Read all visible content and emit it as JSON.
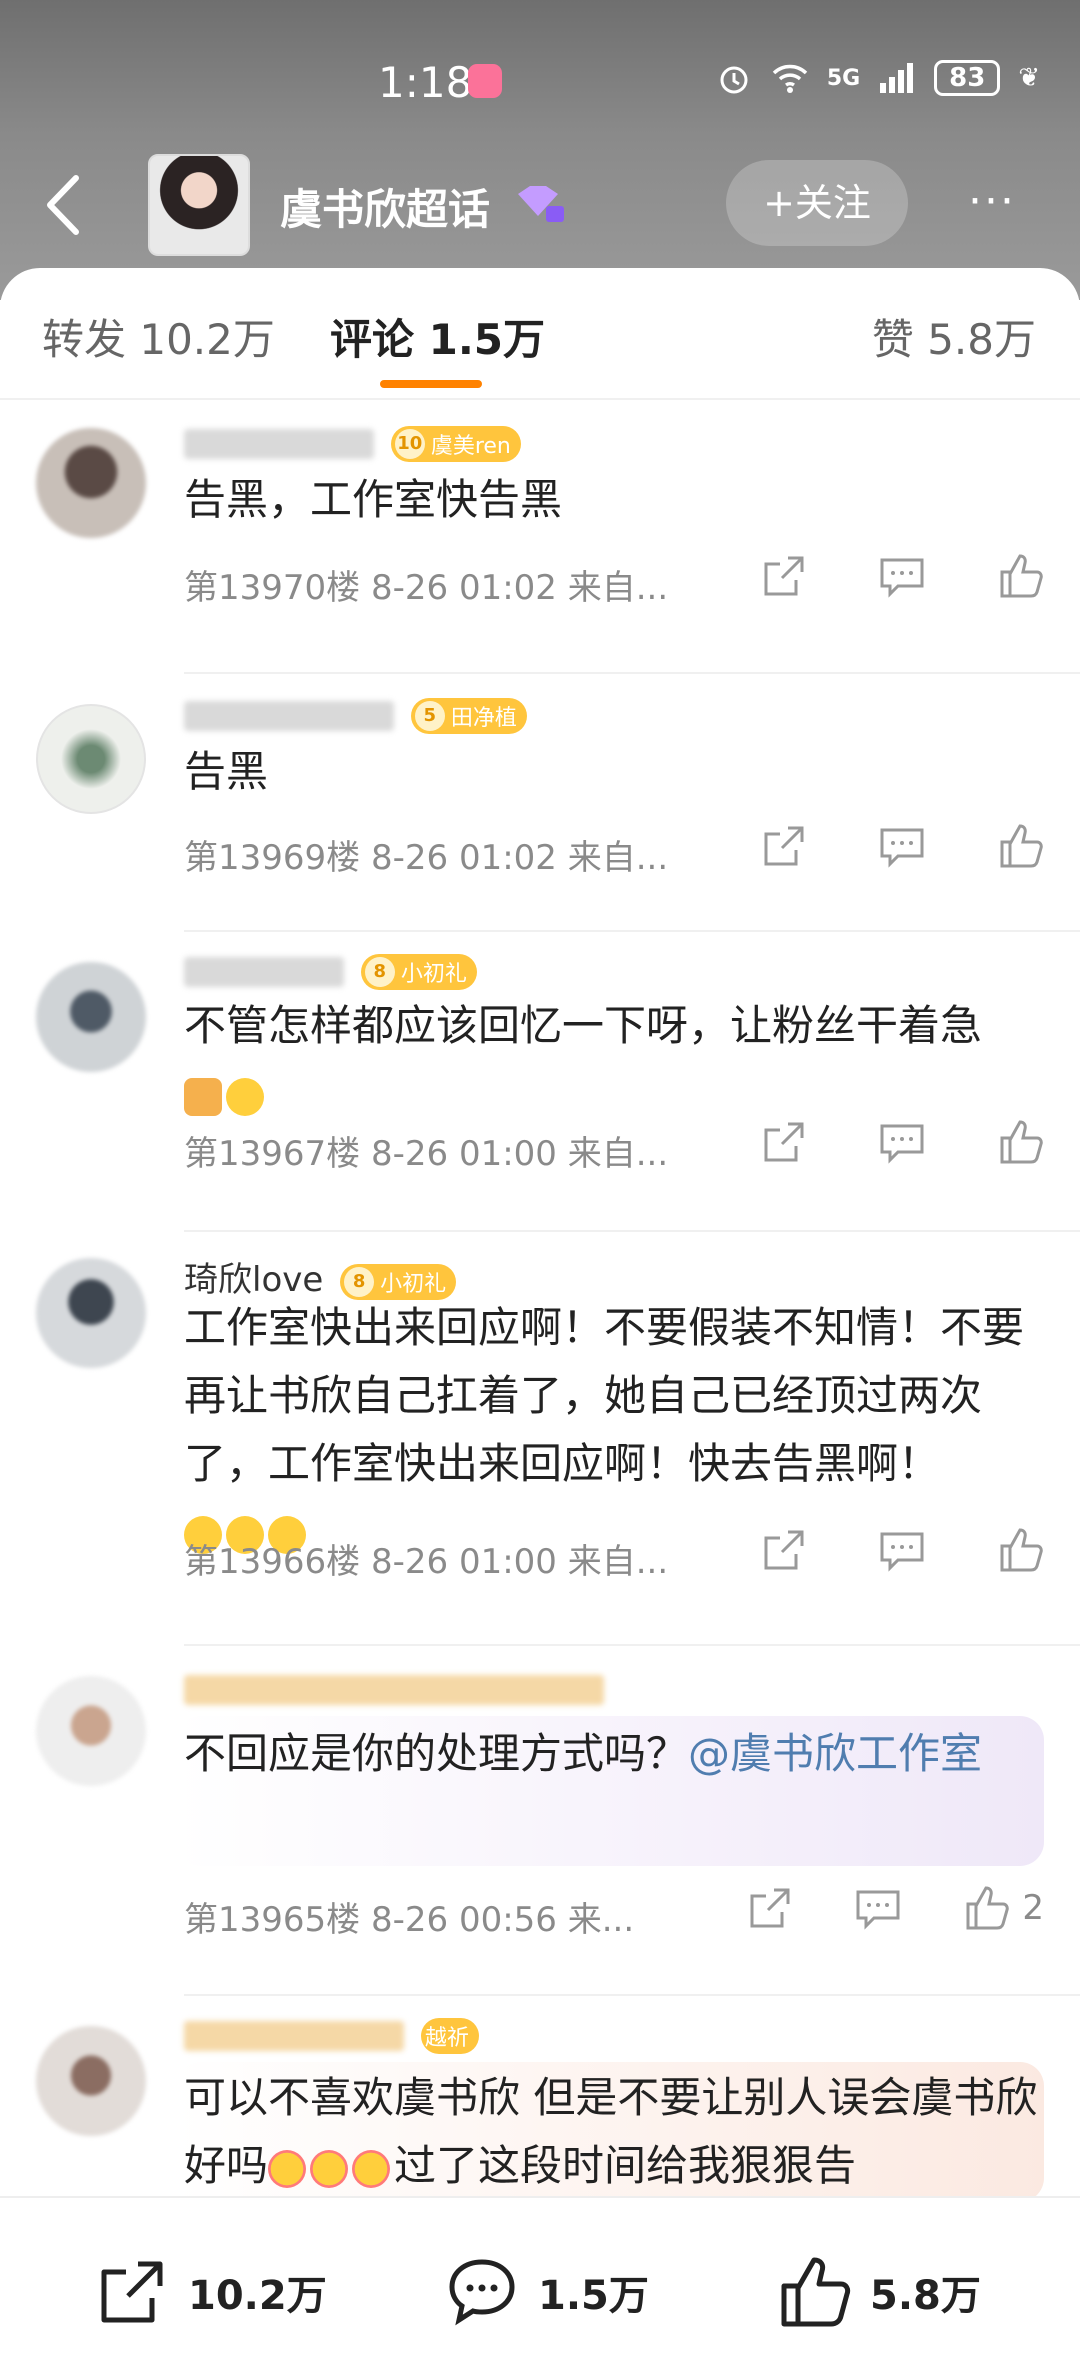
{
  "status_bar": {
    "time": "1:18",
    "network": "5G",
    "battery": "83"
  },
  "header": {
    "title": "虞书欣超话",
    "follow_label": "+关注",
    "more_label": "···"
  },
  "tabs": {
    "repost": "转发 10.2万",
    "comment": "评论 1.5万",
    "like": "赞 5.8万"
  },
  "comments": [
    {
      "name": "",
      "badge_level": "10",
      "badge_text": "虞美ren",
      "text": "告黑，工作室快告黑",
      "meta": "第13970楼  8-26 01:02  来自...",
      "likes": ""
    },
    {
      "name": "",
      "badge_level": "5",
      "badge_text": "田净植",
      "text": "告黑",
      "meta": "第13969楼  8-26 01:02  来自...",
      "likes": ""
    },
    {
      "name": "",
      "badge_level": "8",
      "badge_text": "小初礼",
      "text": "不管怎样都应该回忆一下呀，让粉丝干着急",
      "meta": "第13967楼  8-26 01:00  来自...",
      "likes": ""
    },
    {
      "name": "琦欣love",
      "badge_level": "8",
      "badge_text": "小初礼",
      "text": "工作室快出来回应啊！不要假装不知情！不要再让书欣自己扛着了，她自己已经顶过两次了，工作室快出来回应啊！快去告黑啊！",
      "meta": "第13966楼  8-26 01:00  来自...",
      "likes": ""
    },
    {
      "name": "",
      "badge_level": "",
      "badge_text": "",
      "text": "不回应是你的处理方式吗？",
      "mention": "@虞书欣工作室",
      "meta": "第13965楼  8-26 00:56  来...",
      "likes": "2"
    },
    {
      "name": "",
      "badge_level": "",
      "badge_text": "越祈",
      "text_a": "可以不喜欢虞书欣 但是不要让别人误会虞书欣好吗",
      "text_b": "过了这段时间给我狠狠告",
      "meta": "",
      "likes": ""
    }
  ],
  "bottom_bar": {
    "repost": "10.2万",
    "comment": "1.5万",
    "like": "5.8万"
  },
  "colors": {
    "accent": "#ff8200",
    "badge": "#ffc53d",
    "mention": "#507daf"
  },
  "icons": [
    "back-icon",
    "gem-icon",
    "share-icon",
    "comment-icon",
    "like-icon"
  ]
}
